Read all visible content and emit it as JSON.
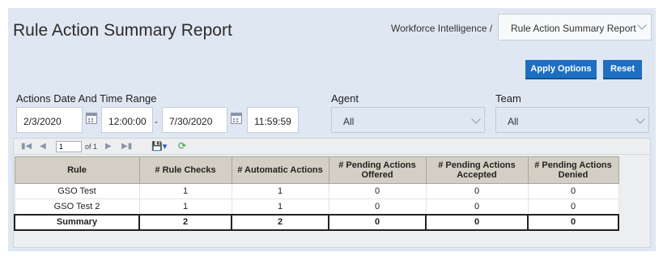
{
  "header": {
    "title": "Rule Action Summary Report",
    "breadcrumb_label": "Workforce Intelligence /",
    "report_select_value": "Rule Action Summary Report"
  },
  "buttons": {
    "apply": "Apply Options",
    "reset": "Reset"
  },
  "filters": {
    "date_range_label": "Actions Date And Time Range",
    "start_date": "2/3/2020",
    "start_time": "12:00:00",
    "separator": "-",
    "end_date": "7/30/2020",
    "end_time": "11:59:59",
    "agent_label": "Agent",
    "agent_value": "All",
    "team_label": "Team",
    "team_value": "All"
  },
  "pager": {
    "page": "1",
    "of_label": "of 1"
  },
  "table": {
    "headers": [
      "Rule",
      "# Rule Checks",
      "# Automatic Actions",
      "# Pending Actions Offered",
      "# Pending Actions Accepted",
      "# Pending Actions Denied"
    ],
    "rows": [
      [
        "GSO Test",
        "1",
        "1",
        "0",
        "0",
        "0"
      ],
      [
        "GSO Test 2",
        "1",
        "1",
        "0",
        "0",
        "0"
      ]
    ],
    "summary": [
      "Summary",
      "2",
      "2",
      "0",
      "0",
      "0"
    ]
  },
  "colors": {
    "accent": "#1e6fc2",
    "panel_bg": "#dfe7f2",
    "header_bg": "#d4cfc4"
  }
}
